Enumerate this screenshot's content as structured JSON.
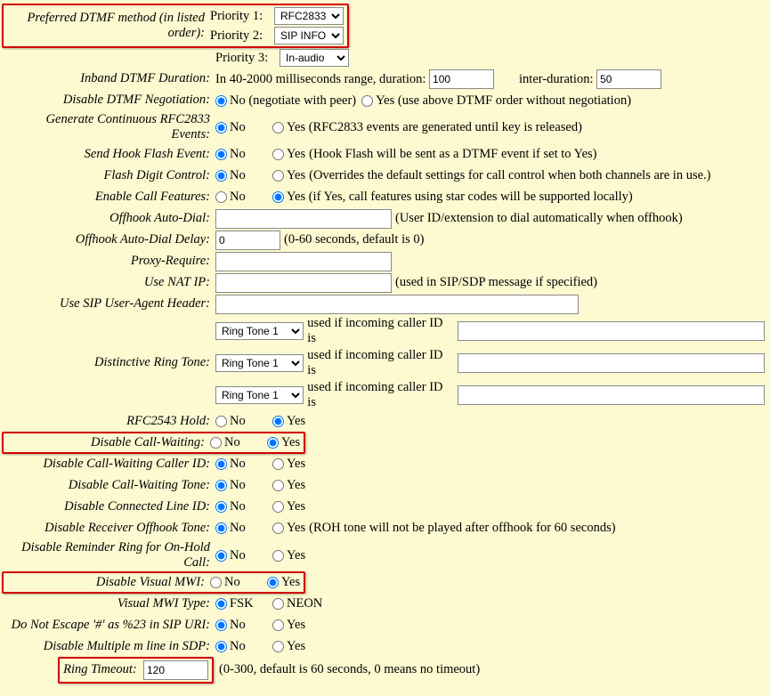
{
  "dtmf": {
    "label": "Preferred DTMF method (in listed order):",
    "p1_label": "Priority 1:",
    "p2_label": "Priority 2:",
    "p3_label": "Priority 3:",
    "p1_value": "RFC2833",
    "p2_value": "SIP INFO",
    "p3_value": "In-audio"
  },
  "inband": {
    "label": "Inband DTMF Duration:",
    "prefix": "In 40-2000 milliseconds range, duration:",
    "dur_value": "100",
    "inter_label": "inter-duration:",
    "inter_value": "50"
  },
  "disable_neg": {
    "label": "Disable DTMF Negotiation:",
    "no": "No (negotiate with peer)",
    "yes": "Yes (use above DTMF order without negotiation)"
  },
  "gen_cont": {
    "label": "Generate Continuous RFC2833 Events:",
    "no": "No",
    "yes": "Yes (RFC2833 events are generated until key is released)"
  },
  "hook_flash": {
    "label": "Send Hook Flash Event:",
    "no": "No",
    "yes": "Yes",
    "note": "(Hook Flash will be sent as a DTMF event if set to Yes)"
  },
  "flash_digit": {
    "label": "Flash Digit Control:",
    "no": "No",
    "yes": "Yes",
    "note": "(Overrides the default settings for call control when both channels are in use.)"
  },
  "call_feat": {
    "label": "Enable Call Features:",
    "no": "No",
    "yes": "Yes (if Yes, call features using star codes will be supported locally)"
  },
  "offhook_auto": {
    "label": "Offhook Auto-Dial:",
    "value": "",
    "note": "(User ID/extension to dial automatically when offhook)"
  },
  "offhook_delay": {
    "label": "Offhook Auto-Dial Delay:",
    "value": "0",
    "note": "(0-60 seconds, default is 0)"
  },
  "proxy_require": {
    "label": "Proxy-Require:",
    "value": ""
  },
  "nat_ip": {
    "label": "Use NAT IP:",
    "value": "",
    "note": "(used in SIP/SDP message if specified)"
  },
  "ua_header": {
    "label": "Use SIP User-Agent Header:",
    "value": ""
  },
  "ring_tone": {
    "label": "Distinctive Ring Tone:",
    "opt": "Ring Tone 1",
    "use": "used if incoming caller ID is",
    "v1": "",
    "v2": "",
    "v3": ""
  },
  "rfc2543": {
    "label": "RFC2543 Hold:",
    "no": "No",
    "yes": "Yes"
  },
  "dis_cw": {
    "label": "Disable Call-Waiting:",
    "no": "No",
    "yes": "Yes"
  },
  "dis_cw_cid": {
    "label": "Disable Call-Waiting Caller ID:",
    "no": "No",
    "yes": "Yes"
  },
  "dis_cw_tone": {
    "label": "Disable Call-Waiting Tone:",
    "no": "No",
    "yes": "Yes"
  },
  "dis_conn": {
    "label": "Disable Connected Line ID:",
    "no": "No",
    "yes": "Yes"
  },
  "dis_roh": {
    "label": "Disable Receiver Offhook Tone:",
    "no": "No",
    "yes": "Yes",
    "note": "(ROH tone will not be played after offhook for 60 seconds)"
  },
  "dis_reminder": {
    "label": "Disable Reminder Ring for On-Hold Call:",
    "no": "No",
    "yes": "Yes"
  },
  "dis_vmwi": {
    "label": "Disable Visual MWI:",
    "no": "No",
    "yes": "Yes"
  },
  "vmwi_type": {
    "label": "Visual MWI Type:",
    "a": "FSK",
    "b": "NEON"
  },
  "no_escape": {
    "label": "Do Not Escape '#' as %23 in SIP URI:",
    "no": "No",
    "yes": "Yes"
  },
  "dis_multi_m": {
    "label": "Disable Multiple m line in SDP:",
    "no": "No",
    "yes": "Yes"
  },
  "ring_timeout": {
    "label": "Ring Timeout:",
    "value": "120",
    "note": "(0-300, default is 60 seconds, 0 means no timeout)"
  }
}
